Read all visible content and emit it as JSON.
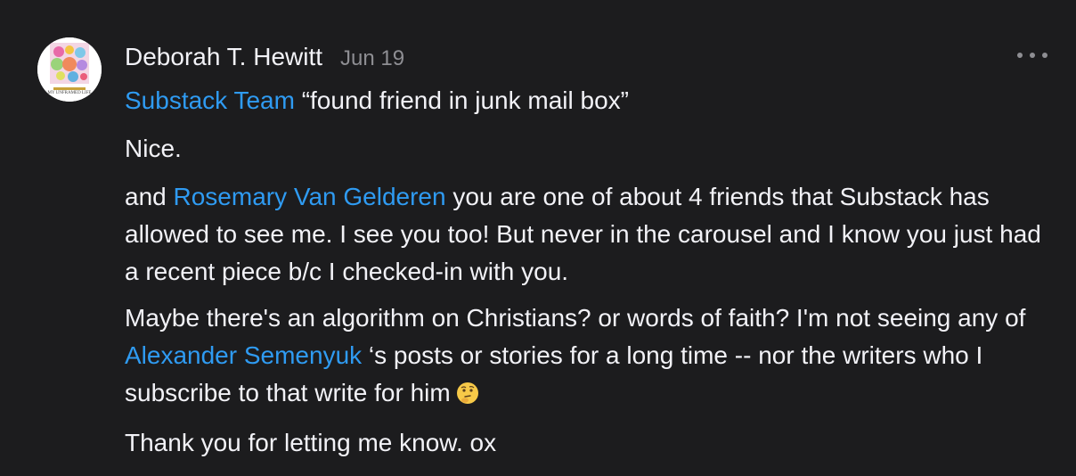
{
  "comment": {
    "author": "Deborah T. Hewitt",
    "date": "Jun 19",
    "avatar_icon": "profile-collage-avatar",
    "avatar_caption": "MY UNFRAMED LIFE",
    "more_icon": "ellipsis-icon",
    "link_color": "#2f9bf2",
    "paragraphs": {
      "p1": {
        "mention": "Substack Team",
        "text": " “found friend in junk mail box”"
      },
      "p2": {
        "text": "Nice."
      },
      "p3": {
        "before": "and ",
        "mention": "Rosemary Van Gelderen",
        "after": " you are one of about 4 friends that Substack has allowed to see me. I see you too! But never in the carousel and I know you just had a recent piece b/c I checked-in with you."
      },
      "p4": {
        "before": "Maybe there's an algorithm on Christians? or words of faith? I'm not seeing any of ",
        "mention": "Alexander Semenyuk",
        "after": " ‘s posts or stories for a long time -- nor the writers who I subscribe to that write for him",
        "emoji_icon": "thinking-face-emoji"
      },
      "p5": {
        "text": "Thank you for letting me know. ox"
      }
    }
  }
}
